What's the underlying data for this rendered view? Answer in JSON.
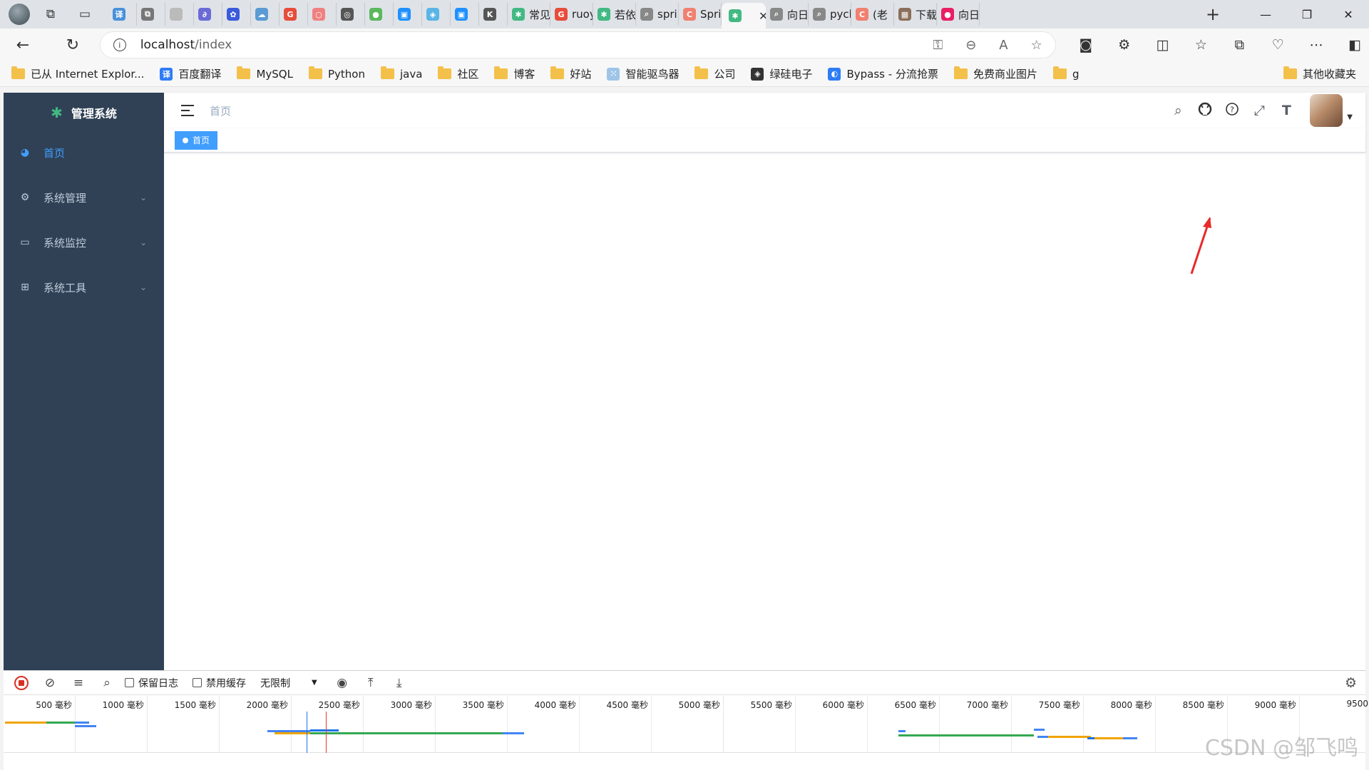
{
  "browser": {
    "tabs": [
      {
        "label": "",
        "color": "#4a90d9",
        "glyph": "译"
      },
      {
        "label": "",
        "color": "#777777",
        "glyph": "⧉"
      },
      {
        "label": "",
        "color": "#bbbbbb",
        "glyph": ""
      },
      {
        "label": "",
        "color": "#6b6bd6",
        "glyph": "∂"
      },
      {
        "label": "",
        "color": "#3b5bdb",
        "glyph": "✿"
      },
      {
        "label": "",
        "color": "#5b9bd5",
        "glyph": "☁"
      },
      {
        "label": "",
        "color": "#e74c3c",
        "glyph": "G"
      },
      {
        "label": "",
        "color": "#f08080",
        "glyph": "○"
      },
      {
        "label": "",
        "color": "#555555",
        "glyph": "◎"
      },
      {
        "label": "",
        "color": "#5cb85c",
        "glyph": "●"
      },
      {
        "label": "",
        "color": "#1e90ff",
        "glyph": "▣"
      },
      {
        "label": "",
        "color": "#5ab4e6",
        "glyph": "◈"
      },
      {
        "label": "",
        "color": "#1e90ff",
        "glyph": "▣"
      },
      {
        "label": "",
        "color": "#555555",
        "glyph": "K"
      },
      {
        "label": "常见",
        "color": "#42b983",
        "glyph": "✱"
      },
      {
        "label": "ruoy",
        "color": "#e74c3c",
        "glyph": "G"
      },
      {
        "label": "若依",
        "color": "#42b983",
        "glyph": "✱"
      },
      {
        "label": "spri",
        "color": "#888888",
        "glyph": "⌕"
      },
      {
        "label": "Spri",
        "color": "#f08070",
        "glyph": "C"
      },
      {
        "label": "",
        "color": "#42b983",
        "glyph": "✱",
        "active": true
      },
      {
        "label": "向日",
        "color": "#888888",
        "glyph": "⌕"
      },
      {
        "label": "pych",
        "color": "#888888",
        "glyph": "⌕"
      },
      {
        "label": "(老",
        "color": "#f08070",
        "glyph": "C"
      },
      {
        "label": "下载",
        "color": "#8b6f5a",
        "glyph": "▦"
      },
      {
        "label": "向日",
        "color": "#e91e63",
        "glyph": "●"
      }
    ],
    "new_tab": "+",
    "url_host": "localhost",
    "url_path": "/index",
    "bookmarks": [
      {
        "label": "已从 Internet Explor...",
        "type": "folder"
      },
      {
        "label": "百度翻译",
        "type": "site",
        "color": "#2e7cf6",
        "glyph": "译"
      },
      {
        "label": "MySQL",
        "type": "folder"
      },
      {
        "label": "Python",
        "type": "folder"
      },
      {
        "label": "java",
        "type": "folder"
      },
      {
        "label": "社区",
        "type": "folder"
      },
      {
        "label": "博客",
        "type": "folder"
      },
      {
        "label": "好站",
        "type": "folder"
      },
      {
        "label": "智能驱鸟器",
        "type": "site",
        "color": "#9ec5e8",
        "glyph": "⁙"
      },
      {
        "label": "公司",
        "type": "folder"
      },
      {
        "label": "绿硅电子",
        "type": "site",
        "color": "#333333",
        "glyph": "◈"
      },
      {
        "label": "Bypass - 分流抢票",
        "type": "site",
        "color": "#2e7cf6",
        "glyph": "◐"
      },
      {
        "label": "免费商业图片",
        "type": "folder"
      },
      {
        "label": "g",
        "type": "folder"
      }
    ],
    "other_bookmarks": "其他收藏夹"
  },
  "app": {
    "title": "管理系统",
    "menu": [
      {
        "label": "首页",
        "icon": "dashboard-icon",
        "glyph": "◕",
        "active": true,
        "expandable": false
      },
      {
        "label": "系统管理",
        "icon": "settings-icon",
        "glyph": "⚙",
        "active": false,
        "expandable": true
      },
      {
        "label": "系统监控",
        "icon": "monitor-icon",
        "glyph": "▭",
        "active": false,
        "expandable": true
      },
      {
        "label": "系统工具",
        "icon": "toolbox-icon",
        "glyph": "⊞",
        "active": false,
        "expandable": true
      }
    ],
    "breadcrumb": "首页",
    "tag": "首页",
    "accent": "#409eff",
    "sidebar_bg": "#304156"
  },
  "devtools": {
    "preserve_log": "保留日志",
    "disable_cache": "禁用缓存",
    "throttle": "无限制",
    "ticks": [
      "500 毫秒",
      "1000 毫秒",
      "1500 毫秒",
      "2000 毫秒",
      "2500 毫秒",
      "3000 毫秒",
      "3500 毫秒",
      "4000 毫秒",
      "4500 毫秒",
      "5000 毫秒",
      "5500 毫秒",
      "6000 毫秒",
      "6500 毫秒",
      "7000 毫秒",
      "7500 毫秒",
      "8000 毫秒",
      "8500 毫秒",
      "9000 毫秒",
      "9500"
    ]
  },
  "watermark": "CSDN @邹飞鸣"
}
